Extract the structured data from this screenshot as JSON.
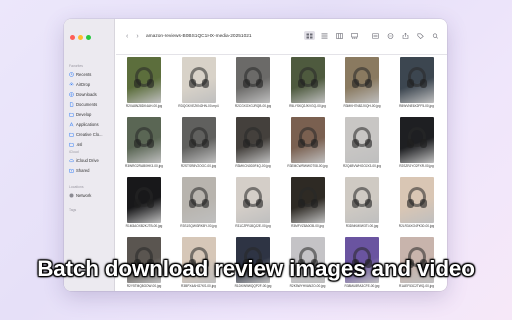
{
  "window": {
    "title": "amazon-reviews-B0BS1QC1HX-media-20251021"
  },
  "sidebar": {
    "favorites_header": "Favorites",
    "favorites": [
      {
        "label": "Recents",
        "icon": "clock-icon"
      },
      {
        "label": "AirDrop",
        "icon": "airdrop-icon"
      },
      {
        "label": "Downloads",
        "icon": "download-icon"
      },
      {
        "label": "Documents",
        "icon": "document-icon"
      },
      {
        "label": "Develop",
        "icon": "folder-icon"
      },
      {
        "label": "Applications",
        "icon": "applications-icon"
      },
      {
        "label": "Creative Clo...",
        "icon": "folder-icon"
      },
      {
        "label": ".ssl",
        "icon": "folder-icon"
      }
    ],
    "icloud_header": "iCloud",
    "icloud": [
      {
        "label": "iCloud Drive",
        "icon": "cloud-icon"
      },
      {
        "label": "Shared",
        "icon": "shared-folder-icon"
      }
    ],
    "locations_header": "Locations",
    "locations": [
      {
        "label": "Network",
        "icon": "network-icon"
      }
    ],
    "tags_header": "Tags"
  },
  "toolbar": {
    "back_glyph": "‹",
    "forward_glyph": "›",
    "icons": [
      "icon-view-icon",
      "list-view-icon",
      "column-view-icon",
      "gallery-view-icon",
      "group-icon",
      "action-icon",
      "share-icon",
      "tag-icon",
      "search-icon"
    ]
  },
  "files": [
    {
      "name": "R2XA8N28DK4AH-00.jpg",
      "bg": "#5c6e3c"
    },
    {
      "name": "RDQGKVEZKN2HN-00.mp4",
      "bg": "#d8d2c8"
    },
    {
      "name": "R2CGXOXGJRQB-00.jpg",
      "bg": "#6b6a68"
    },
    {
      "name": "R5LYSKQ2JKVGQ-00.jpg",
      "bg": "#4e5a3e"
    },
    {
      "name": "R3MKH7N82JXQH-00.jpg",
      "bg": "#8a7a60"
    },
    {
      "name": "R8WVNE6X2FF5-00.jpg",
      "bg": "#3c4650"
    },
    {
      "name": "R3WRG2RAB0HK3-00.jpg",
      "bg": "#5a6654"
    },
    {
      "name": "R2STSR8V2OOC-00.jpg",
      "bg": "#60605e"
    },
    {
      "name": "R3MKCN0D0F4Q-00.jpg",
      "bg": "#44403c"
    },
    {
      "name": "R3EMCWRWWOT08-00.jpg",
      "bg": "#7a6050"
    },
    {
      "name": "R2Q4BVWHGOJX3-00.jpg",
      "bg": "#c8c6c4"
    },
    {
      "name": "R2SZRJYO2FXR-00.jpg",
      "bg": "#1e1f22"
    },
    {
      "name": "R1M3AOXB2KJTB-00.jpg",
      "bg": "#18181a"
    },
    {
      "name": "R3S1SQWI3RKBY-00.jpg",
      "bg": "#b8b4ae"
    },
    {
      "name": "R31CZPRJ8QJ2E-00.jpg",
      "bg": "#d4cec8"
    },
    {
      "name": "R3MFVZ8A0OB-00.jpg",
      "bg": "#2e2a24"
    },
    {
      "name": "R3DNKM0W3TI-00.jpg",
      "bg": "#cfcac3"
    },
    {
      "name": "R2LR34XO4FK30-00.jpg",
      "bg": "#d9c6b4"
    },
    {
      "name": "R2Y5TMQ8GOW-00.jpg",
      "bg": "#5a5550"
    },
    {
      "name": "R3BPX4AHG7KS-00.jpg",
      "bg": "#d6c7b8"
    },
    {
      "name": "R1DKW9WQQP2F-00.jpg",
      "bg": "#2e3444"
    },
    {
      "name": "R2K5WYHVAN2O-00.jpg",
      "bg": "#c4c3c6"
    },
    {
      "name": "R38MU8RA3CFE-00.jpg",
      "bg": "#6a54a0"
    },
    {
      "name": "R1AEF53C2TWQ-00.jpg",
      "bg": "#c8b4ac"
    }
  ],
  "caption": "Batch download review images and video"
}
